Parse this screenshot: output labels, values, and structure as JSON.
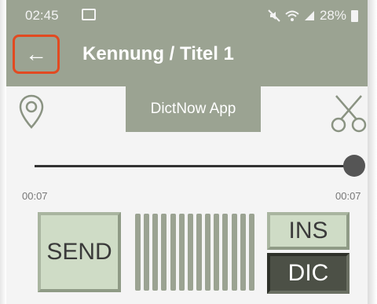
{
  "status_bar": {
    "time": "02:45",
    "battery": "28%"
  },
  "app_bar": {
    "title": "Kennung / Titel 1",
    "back_icon": "←"
  },
  "toast": {
    "text": "DictNow App"
  },
  "player": {
    "time_left": "00:07",
    "time_right": "00:07",
    "position": 1.0
  },
  "buttons": {
    "send": "SEND",
    "insert": "INS",
    "dictate": "DIC"
  },
  "colors": {
    "accent": "#9ba392",
    "highlight": "#e24a21",
    "button_face": "#cfdcc6",
    "button_active": "#4c5046"
  }
}
